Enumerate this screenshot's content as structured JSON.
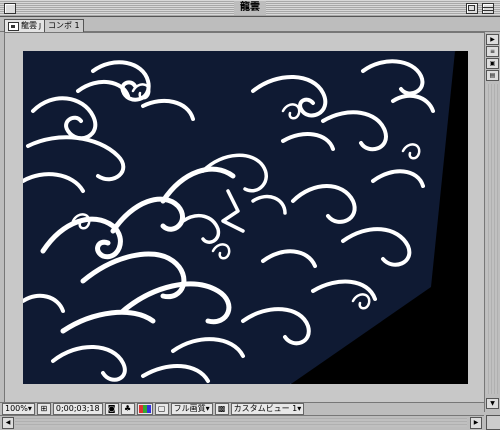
{
  "window": {
    "title": "龍雲"
  },
  "tabs": [
    {
      "label": "龍雲",
      "active": true
    },
    {
      "label": "コンポ 1",
      "active": false
    }
  ],
  "bottom_bar": {
    "zoom": "100%",
    "timecode": "0;00;03;18",
    "resolution": "フル画質",
    "view": "カスタムビュー 1"
  },
  "colors": {
    "comp_background": "#0f1a33",
    "pattern": "#ffffff",
    "pasteboard": "#c8c8c8",
    "chrome": "#bdbdbd"
  },
  "icons": {
    "close": "close-box",
    "zoom": "zoom-box",
    "collapse": "collapse-box",
    "comp": "composition-icon",
    "camera": "camera-icon",
    "channels": "rgb-channels-icon",
    "region": "region-of-interest-icon",
    "safe_zones": "safe-zones-icon"
  }
}
